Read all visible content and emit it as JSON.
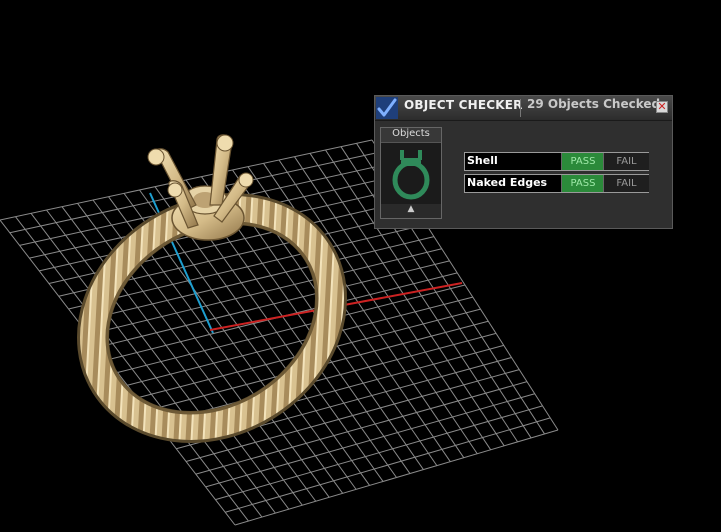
{
  "panel": {
    "title": "OBJECT CHECKER",
    "object_count_text": "29  Objects Checked",
    "close_glyph": "✕",
    "objects_label": "Objects",
    "scroll_up_glyph": "▲",
    "checks": [
      {
        "label": "Shell",
        "pass": "PASS",
        "fail": "FAIL",
        "status": "pass"
      },
      {
        "label": "Naked Edges",
        "pass": "PASS",
        "fail": "FAIL",
        "status": "pass"
      }
    ],
    "colors": {
      "pass_active": "#2b8a3a",
      "thumbnail": "#2f8a5a",
      "ring": "#d9c293"
    }
  },
  "viewport": {
    "background": "#000000",
    "grid_color": "#9a9a9a",
    "x_axis_color": "#cc2222",
    "y_axis_color": "#1e9fd0",
    "object": "twisted rope ring with four-prong setting"
  }
}
